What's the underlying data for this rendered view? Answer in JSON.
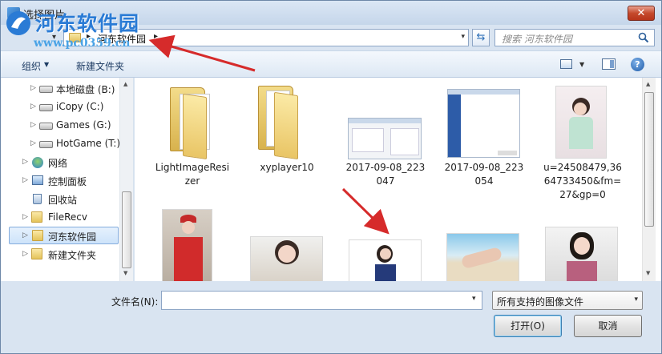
{
  "window": {
    "title": "选择图片",
    "close_label": "✕"
  },
  "watermark": {
    "title": "河东软件园",
    "url": "www.pc0359.cn"
  },
  "address": {
    "crumb": "河东软件园",
    "sep": "▸",
    "dropdown": "▾",
    "refresh": "⇆"
  },
  "search": {
    "placeholder": "搜索 河东软件园"
  },
  "toolbar": {
    "organize_label": "组织",
    "organize_arrow": "▼",
    "new_folder_label": "新建文件夹",
    "view_dropdown": "▼",
    "help_label": "?"
  },
  "sidebar": {
    "items": [
      {
        "label": "本地磁盘 (B:)",
        "icon": "drive-icon",
        "twisty": "▷"
      },
      {
        "label": "iCopy (C:)",
        "icon": "drive-icon",
        "twisty": "▷"
      },
      {
        "label": "Games (G:)",
        "icon": "drive-icon",
        "twisty": "▷"
      },
      {
        "label": "HotGame (T:)",
        "icon": "drive-icon",
        "twisty": "▷"
      },
      {
        "label": "网络",
        "icon": "network-icon",
        "twisty": "▷"
      },
      {
        "label": "控制面板",
        "icon": "control-panel-icon",
        "twisty": "▷"
      },
      {
        "label": "回收站",
        "icon": "recycle-bin-icon",
        "twisty": ""
      },
      {
        "label": "FileRecv",
        "icon": "folder-icon",
        "twisty": "▷"
      },
      {
        "label": "河东软件园",
        "icon": "folder-icon",
        "twisty": "▷",
        "selected": true
      },
      {
        "label": "新建文件夹",
        "icon": "folder-icon",
        "twisty": "▷"
      }
    ]
  },
  "files": [
    {
      "name": "LightImageResizer",
      "line1": "LightImageResi",
      "line2": "zer",
      "type": "folder"
    },
    {
      "name": "xyplayer10",
      "line1": "xyplayer10",
      "line2": "",
      "type": "folder"
    },
    {
      "name": "2017-09-08_223047",
      "line1": "2017-09-08_223",
      "line2": "047",
      "type": "screenshot"
    },
    {
      "name": "2017-09-08_223054",
      "line1": "2017-09-08_223",
      "line2": "054",
      "type": "screenshot"
    },
    {
      "name": "u=24508479,3664733450&fm=27&gp=0",
      "line1": "u=24508479,36",
      "line2": "64733450&fm=",
      "line3": "27&gp=0",
      "type": "photo"
    },
    {
      "name": "",
      "type": "photo"
    },
    {
      "name": "",
      "type": "photo"
    },
    {
      "name": "",
      "type": "photo"
    },
    {
      "name": "",
      "type": "photo"
    },
    {
      "name": "",
      "type": "photo"
    }
  ],
  "bottom": {
    "filename_label": "文件名(N):",
    "filename_value": "",
    "filename_dropdown": "▾",
    "filter_label": "所有支持的图像文件",
    "filter_dropdown": "▾",
    "open_label": "打开(O)",
    "cancel_label": "取消"
  },
  "colors": {
    "accent": "#3c7fb1",
    "annotation_arrow": "#d62b2b",
    "watermark": "#2a7bd5"
  }
}
